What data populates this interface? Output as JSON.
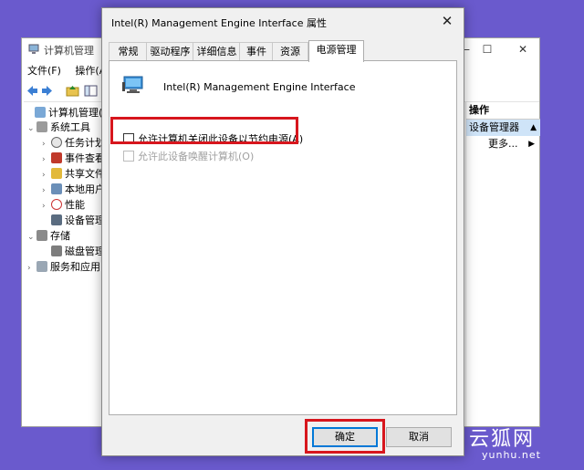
{
  "bg_window": {
    "title": "计算机管理",
    "minimize": "—",
    "maximize": "☐",
    "close": "✕",
    "menu": [
      "文件(F)",
      "操作(A)"
    ],
    "tree": [
      {
        "label": "计算机管理(本地",
        "arrow": "",
        "icon": "computer-management-icon"
      },
      {
        "label": "系统工具",
        "arrow": "⌄",
        "icon": "tools-icon"
      },
      {
        "label": "任务计划",
        "arrow": "›",
        "icon": "task-scheduler-icon"
      },
      {
        "label": "事件查看",
        "arrow": "›",
        "icon": "event-viewer-icon"
      },
      {
        "label": "共享文件",
        "arrow": "›",
        "icon": "shared-folders-icon"
      },
      {
        "label": "本地用户",
        "arrow": "›",
        "icon": "local-users-icon"
      },
      {
        "label": "性能",
        "arrow": "›",
        "icon": "performance-icon"
      },
      {
        "label": "设备管理",
        "arrow": "",
        "icon": "device-manager-icon"
      },
      {
        "label": "存储",
        "arrow": "⌄",
        "icon": "storage-icon"
      },
      {
        "label": "磁盘管理",
        "arrow": "",
        "icon": "disk-management-icon"
      },
      {
        "label": "服务和应用",
        "arrow": "›",
        "icon": "services-icon"
      }
    ],
    "actions": {
      "header": "操作",
      "selected": "设备管理器",
      "selected_arrow": "▲",
      "more": "更多...",
      "more_arrow": "▶"
    }
  },
  "dialog": {
    "title": "Intel(R) Management Engine Interface  属性",
    "close": "✕",
    "tabs": [
      "常规",
      "驱动程序",
      "详细信息",
      "事件",
      "资源",
      "电源管理"
    ],
    "active_tab": "电源管理",
    "device_name": "Intel(R) Management Engine Interface",
    "options": [
      {
        "label": "允许计算机关闭此设备以节约电源(A)",
        "checked": false,
        "enabled": true,
        "highlighted": true
      },
      {
        "label": "允许此设备唤醒计算机(O)",
        "checked": false,
        "enabled": false,
        "highlighted": false
      }
    ],
    "ok_label": "确定",
    "cancel_label": "取消",
    "highlight_color": "#d7161d",
    "accent_color": "#0078d7"
  },
  "watermark": {
    "text": "云狐网",
    "url": "yunhu.net"
  }
}
